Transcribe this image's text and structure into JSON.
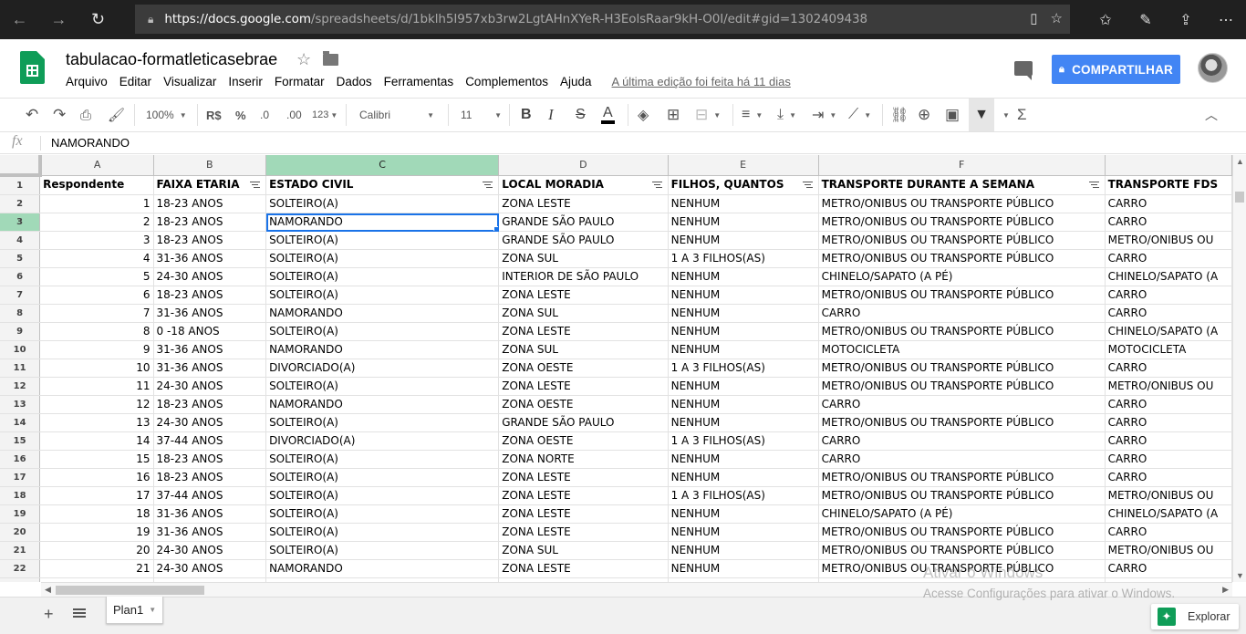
{
  "browser": {
    "back": "←",
    "forward": "→",
    "refresh": "↻",
    "url_host": "https://docs.google.com",
    "url_path": "/spreadsheets/d/1bklh5I957xb3rw2LgtAHnXYeR-H3EolsRaar9kH-O0I/edit#gid=1302409438"
  },
  "doc": {
    "title": "tabulacao-formatleticasebrae",
    "menu": [
      "Arquivo",
      "Editar",
      "Visualizar",
      "Inserir",
      "Formatar",
      "Dados",
      "Ferramentas",
      "Complementos",
      "Ajuda"
    ],
    "last_edit": "A última edição foi feita há 11 dias",
    "share_label": "COMPARTILHAR"
  },
  "toolbar": {
    "zoom": "100%",
    "currency": "R$",
    "percent": "%",
    "dec_decrease": ".0",
    "dec_increase": ".00",
    "more_formats": "123",
    "font": "Calibri",
    "font_size": "11",
    "bold": "B",
    "italic": "I",
    "strike": "S",
    "text_color": "A"
  },
  "formula": {
    "fx": "fx",
    "value": "NAMORANDO"
  },
  "grid": {
    "columns": [
      "A",
      "B",
      "C",
      "D",
      "E",
      "F",
      "G"
    ],
    "header_row": [
      "Respondente",
      "FAIXA ETARIA",
      "ESTADO CIVIL",
      "LOCAL MORADIA",
      "FILHOS, QUANTOS",
      "TRANSPORTE DURANTE A SEMANA",
      "TRANSPORTE FDS"
    ],
    "rows": [
      [
        "1",
        "18-23 ANOS",
        "SOLTEIRO(A)",
        "ZONA LESTE",
        "NENHUM",
        "METRO/ONIBUS OU TRANSPORTE PÚBLICO",
        "CARRO"
      ],
      [
        "2",
        "18-23 ANOS",
        "NAMORANDO",
        "GRANDE SÃO PAULO",
        "NENHUM",
        "METRO/ONIBUS OU TRANSPORTE PÚBLICO",
        "CARRO"
      ],
      [
        "3",
        "18-23 ANOS",
        "SOLTEIRO(A)",
        "GRANDE SÃO PAULO",
        "NENHUM",
        "METRO/ONIBUS OU TRANSPORTE PÚBLICO",
        "METRO/ONIBUS OU"
      ],
      [
        "4",
        "31-36 ANOS",
        "SOLTEIRO(A)",
        "ZONA SUL",
        "1 A 3 FILHOS(AS)",
        "METRO/ONIBUS OU TRANSPORTE PÚBLICO",
        "CARRO"
      ],
      [
        "5",
        "24-30 ANOS",
        "SOLTEIRO(A)",
        "INTERIOR DE SÃO PAULO",
        "NENHUM",
        "CHINELO/SAPATO (A PÉ)",
        "CHINELO/SAPATO (A"
      ],
      [
        "6",
        "18-23 ANOS",
        "SOLTEIRO(A)",
        "ZONA LESTE",
        "NENHUM",
        "METRO/ONIBUS OU TRANSPORTE PÚBLICO",
        "CARRO"
      ],
      [
        "7",
        "31-36 ANOS",
        "NAMORANDO",
        "ZONA SUL",
        "NENHUM",
        "CARRO",
        "CARRO"
      ],
      [
        "8",
        "0 -18 ANOS",
        "SOLTEIRO(A)",
        "ZONA LESTE",
        "NENHUM",
        "METRO/ONIBUS OU TRANSPORTE PÚBLICO",
        "CHINELO/SAPATO (A"
      ],
      [
        "9",
        "31-36 ANOS",
        "NAMORANDO",
        "ZONA SUL",
        "NENHUM",
        "MOTOCICLETA",
        "MOTOCICLETA"
      ],
      [
        "10",
        "31-36 ANOS",
        "DIVORCIADO(A)",
        "ZONA OESTE",
        "1 A 3 FILHOS(AS)",
        "METRO/ONIBUS OU TRANSPORTE PÚBLICO",
        "CARRO"
      ],
      [
        "11",
        "24-30 ANOS",
        "SOLTEIRO(A)",
        "ZONA LESTE",
        "NENHUM",
        "METRO/ONIBUS OU TRANSPORTE PÚBLICO",
        "METRO/ONIBUS OU"
      ],
      [
        "12",
        "18-23 ANOS",
        "NAMORANDO",
        "ZONA OESTE",
        "NENHUM",
        "CARRO",
        "CARRO"
      ],
      [
        "13",
        "24-30 ANOS",
        "SOLTEIRO(A)",
        "GRANDE SÃO PAULO",
        "NENHUM",
        "METRO/ONIBUS OU TRANSPORTE PÚBLICO",
        "CARRO"
      ],
      [
        "14",
        "37-44 ANOS",
        "DIVORCIADO(A)",
        "ZONA OESTE",
        "1 A 3 FILHOS(AS)",
        "CARRO",
        "CARRO"
      ],
      [
        "15",
        "18-23 ANOS",
        "SOLTEIRO(A)",
        "ZONA NORTE",
        "NENHUM",
        "CARRO",
        "CARRO"
      ],
      [
        "16",
        "18-23 ANOS",
        "SOLTEIRO(A)",
        "ZONA LESTE",
        "NENHUM",
        "METRO/ONIBUS OU TRANSPORTE PÚBLICO",
        "CARRO"
      ],
      [
        "17",
        "37-44 ANOS",
        "SOLTEIRO(A)",
        "ZONA LESTE",
        "1 A 3 FILHOS(AS)",
        "METRO/ONIBUS OU TRANSPORTE PÚBLICO",
        "METRO/ONIBUS OU"
      ],
      [
        "18",
        "31-36 ANOS",
        "SOLTEIRO(A)",
        "ZONA LESTE",
        "NENHUM",
        "CHINELO/SAPATO (A PÉ)",
        "CHINELO/SAPATO (A"
      ],
      [
        "19",
        "31-36 ANOS",
        "SOLTEIRO(A)",
        "ZONA LESTE",
        "NENHUM",
        "METRO/ONIBUS OU TRANSPORTE PÚBLICO",
        "CARRO"
      ],
      [
        "20",
        "24-30 ANOS",
        "SOLTEIRO(A)",
        "ZONA SUL",
        "NENHUM",
        "METRO/ONIBUS OU TRANSPORTE PÚBLICO",
        "METRO/ONIBUS OU"
      ],
      [
        "21",
        "24-30 ANOS",
        "NAMORANDO",
        "ZONA LESTE",
        "NENHUM",
        "METRO/ONIBUS OU TRANSPORTE PÚBLICO",
        "CARRO"
      ]
    ],
    "selected_cell": "C3",
    "selected_column": "C",
    "selected_row": "3"
  },
  "bottom": {
    "add_sheet": "+",
    "sheet_tab": "Plan1",
    "explore_label": "Explorar"
  },
  "watermark": {
    "line1": "Ativar o Windows",
    "line2": "Acesse Configurações para ativar o Windows."
  },
  "colors": {
    "accent": "#4285f4",
    "sheets_green": "#0f9d58",
    "selected_header": "#a1d9b8",
    "selection_border": "#1a73e8"
  }
}
